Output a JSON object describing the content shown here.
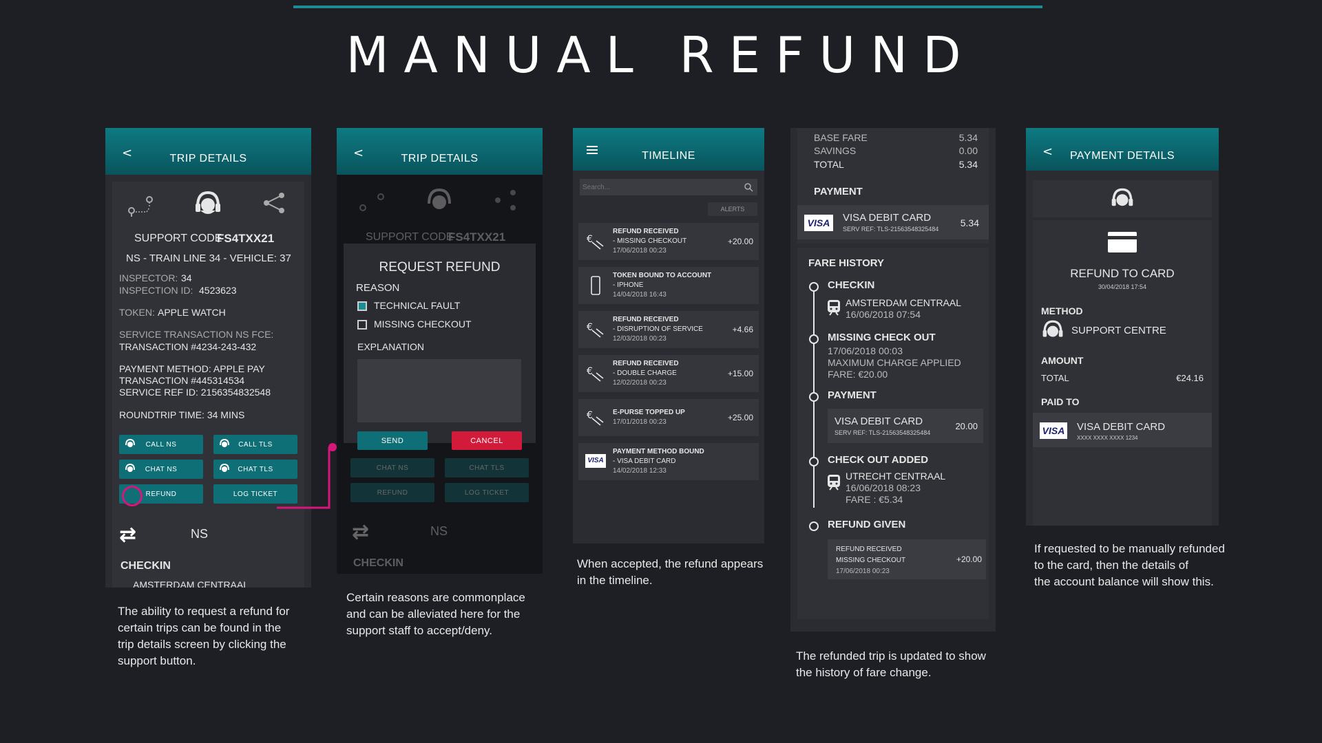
{
  "page": {
    "title": "MANUAL REFUND"
  },
  "screen1": {
    "header": {
      "back": "<",
      "title": "TRIP DETAILS"
    },
    "support_code_label": "SUPPORT CODE",
    "support_code": "FS4TXX21",
    "line_info": "NS - TRAIN LINE 34 - VEHICLE: 37",
    "inspector_label": "INSPECTOR:",
    "inspector": "34",
    "inspection_id_label": "INSPECTION ID:",
    "inspection_id": "4523623",
    "token_label": "TOKEN:",
    "token": "APPLE WATCH",
    "service_tx_label": "SERVICE TRANSACTION NS FCE:",
    "service_tx": "TRANSACTION #4234-243-432",
    "payment_method": "PAYMENT METHOD: APPLE PAY",
    "payment_tx": "TRANSACTION #445314534",
    "service_ref": "SERVICE REF ID: 2156354832548",
    "roundtrip": "ROUNDTRIP TIME: 34 MINS",
    "buttons": {
      "call_ns": "CALL NS",
      "call_tls": "CALL TLS",
      "chat_ns": "CHAT NS",
      "chat_tls": "CHAT TLS",
      "refund": "REFUND",
      "log_ticket": "LOG TICKET"
    },
    "operator": "NS",
    "checkin": "CHECKIN",
    "checkin_station": "AMSTERDAM CENTRAAL",
    "caption": [
      "The ability to request a refund for",
      "certain trips can be found in the",
      "trip details screen by clicking the",
      "support button."
    ]
  },
  "screen2": {
    "header": {
      "back": "<",
      "title": "TRIP DETAILS"
    },
    "support_code_label": "SUPPORT CODE",
    "support_code": "FS4TXX21",
    "modal_title": "REQUEST REFUND",
    "reason_label": "REASON",
    "reasons": [
      "TECHNICAL FAULT",
      "MISSING CHECKOUT"
    ],
    "explanation_label": "EXPLANATION",
    "send": "SEND",
    "cancel": "CANCEL",
    "bg_buttons": [
      "CHAT NS",
      "CHAT TLS",
      "REFUND",
      "LOG TICKET"
    ],
    "operator": "NS",
    "checkin": "CHECKIN",
    "caption": [
      "Certain reasons are commonplace",
      "and can be alleviated here for the",
      "support staff to accept/deny."
    ]
  },
  "screen3": {
    "header": {
      "title": "TIMELINE"
    },
    "search_placeholder": "Search...",
    "alerts": "ALERTS",
    "rows": [
      {
        "title": "REFUND RECEIVED",
        "sub": "- MISSING CHECKOUT",
        "date": "17/06/2018   00:23",
        "amount": "+20.00"
      },
      {
        "title": "TOKEN BOUND TO ACCOUNT",
        "sub": "- IPHONE",
        "date": "14/04/2018   16:43",
        "amount": ""
      },
      {
        "title": "REFUND RECEIVED",
        "sub": "- DISRUPTION OF SERVICE",
        "date": "12/03/2018   00:23",
        "amount": "+4.66"
      },
      {
        "title": "REFUND RECEIVED",
        "sub": "- DOUBLE CHARGE",
        "date": "12/02/2018   00:23",
        "amount": "+15.00"
      },
      {
        "title": "E-PURSE TOPPED UP",
        "sub": "",
        "date": "17/01/2018   00:23",
        "amount": "+25.00"
      },
      {
        "title": "PAYMENT METHOD BOUND",
        "sub": "- VISA DEBIT CARD",
        "date": "14/02/2018   12:33",
        "amount": ""
      }
    ],
    "caption": [
      "When accepted, the refund appears",
      "in the timeline."
    ]
  },
  "screen4": {
    "base_fare_label": "BASE FARE",
    "base_fare": "5.34",
    "savings_label": "SAVINGS",
    "savings": "0.00",
    "total_label": "TOTAL",
    "total": "5.34",
    "payment_label": "PAYMENT",
    "card_name": "VISA DEBIT CARD",
    "card_ref": "SERV REF: TLS-21563548325484",
    "card_amount": "5.34",
    "visa": "VISA",
    "fare_history": "FARE HISTORY",
    "checkin": "CHECKIN",
    "checkin_station": "AMSTERDAM CENTRAAL",
    "checkin_time": "16/06/2018 07:54",
    "missing": "MISSING CHECK OUT",
    "missing_date": "17/06/2018 00:03",
    "missing_max": "MAXIMUM CHARGE APPLIED",
    "missing_fare": "FARE: €20.00",
    "payment2": "PAYMENT",
    "card2_name": "VISA DEBIT CARD",
    "card2_ref": "SERV REF: TLS-21563548325484",
    "card2_amount": "20.00",
    "checkout_added": "CHECK OUT ADDED",
    "co_station": "UTRECHT CENTRAAL",
    "co_time": "16/06/2018 08:23",
    "co_fare": "FARE : €5.34",
    "refund_given": "REFUND GIVEN",
    "refund_title": "REFUND RECEIVED",
    "refund_sub": "MISSING CHECKOUT",
    "refund_date": "17/06/2018   00:23",
    "refund_amount": "+20.00",
    "caption": [
      "The refunded trip is updated to show",
      "the history of fare change."
    ]
  },
  "screen5": {
    "header": {
      "back": "<",
      "title": "PAYMENT DETAILS"
    },
    "refund_to_card": "REFUND TO CARD",
    "refund_date": "30/04/2018 17:54",
    "method_label": "METHOD",
    "method": "SUPPORT CENTRE",
    "amount_label": "AMOUNT",
    "total_label": "TOTAL",
    "total": "€24.16",
    "paid_to_label": "PAID TO",
    "card_name": "VISA DEBIT CARD",
    "card_mask": "XXXX XXXX XXXX 1234",
    "visa": "VISA",
    "caption": [
      "If requested to be manually refunded",
      "to the card, then the details of",
      "the account balance will show this."
    ]
  },
  "colors": {
    "teal": "#0e7a82",
    "magenta": "#d6177a",
    "cancel_red": "#d21a3a",
    "background": "#1d1f24"
  }
}
